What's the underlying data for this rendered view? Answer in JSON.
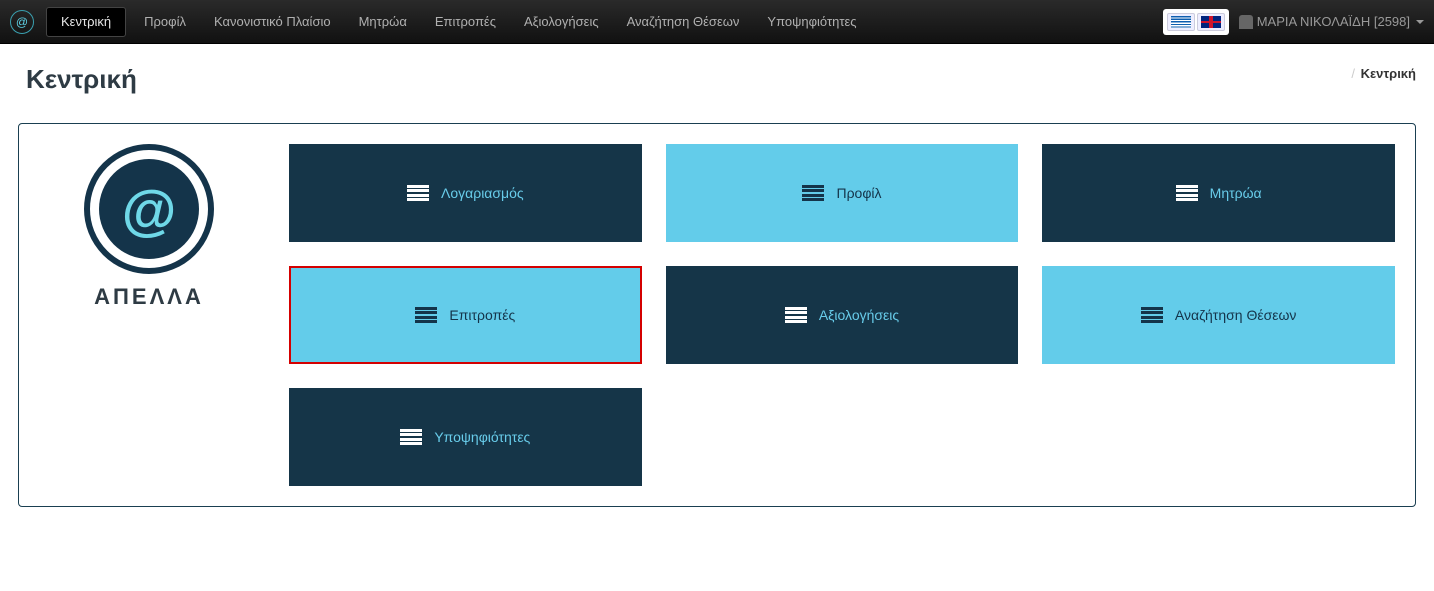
{
  "nav": {
    "items": [
      {
        "label": "Κεντρική",
        "active": true
      },
      {
        "label": "Προφίλ",
        "active": false
      },
      {
        "label": "Κανονιστικό Πλαίσιο",
        "active": false
      },
      {
        "label": "Μητρώα",
        "active": false
      },
      {
        "label": "Επιτροπές",
        "active": false
      },
      {
        "label": "Αξιολογήσεις",
        "active": false
      },
      {
        "label": "Αναζήτηση Θέσεων",
        "active": false
      },
      {
        "label": "Υποψηφιότητες",
        "active": false
      }
    ]
  },
  "user": {
    "display": "ΜΑΡΙΑ ΝΙΚΟΛΑΪΔΗ [2598]"
  },
  "breadcrumb": {
    "current": "Κεντρική"
  },
  "page": {
    "title": "Κεντρική"
  },
  "brand": {
    "glyph": "@",
    "name": "ΑΠΕΛΛΑ"
  },
  "cards": [
    {
      "label": "Λογαριασμός",
      "style": "dark"
    },
    {
      "label": "Προφίλ",
      "style": "light"
    },
    {
      "label": "Μητρώα",
      "style": "dark"
    },
    {
      "label": "Επιτροπές",
      "style": "highlight"
    },
    {
      "label": "Αξιολογήσεις",
      "style": "dark"
    },
    {
      "label": "Αναζήτηση Θέσεων",
      "style": "light"
    },
    {
      "label": "Υποψηφιότητες",
      "style": "dark"
    }
  ]
}
